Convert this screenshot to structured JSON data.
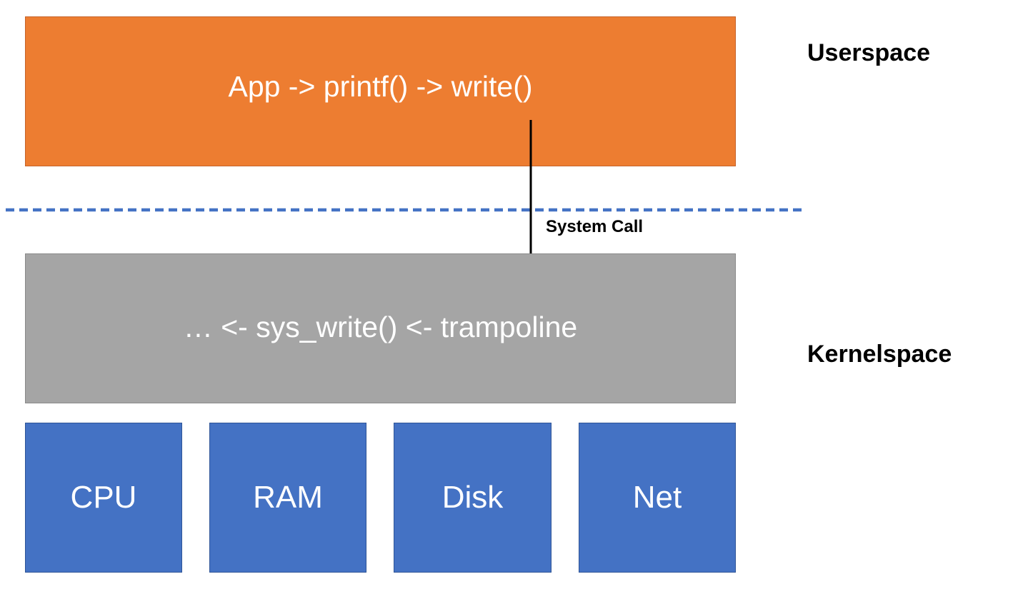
{
  "userspace": {
    "label": "Userspace",
    "box_text": "App -> printf() -> write()",
    "color": "#ed7d31"
  },
  "kernelspace": {
    "label": "Kernelspace",
    "box_text": "… <- sys_write() <- trampoline",
    "color": "#a5a5a5"
  },
  "boundary": {
    "style": "dashed",
    "color": "#4472c4"
  },
  "arrow": {
    "label": "System Call",
    "direction": "down"
  },
  "hardware": {
    "color": "#4472c4",
    "items": [
      "CPU",
      "RAM",
      "Disk",
      "Net"
    ]
  }
}
